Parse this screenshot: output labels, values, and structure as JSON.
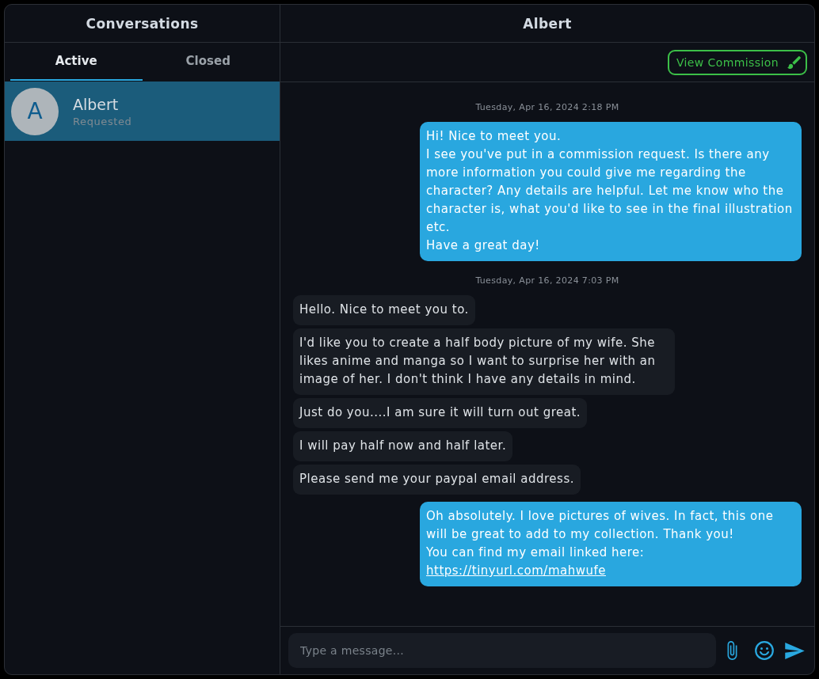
{
  "sidebar": {
    "title": "Conversations",
    "tabs": [
      {
        "label": "Active",
        "selected": true
      },
      {
        "label": "Closed",
        "selected": false
      }
    ],
    "conversations": [
      {
        "initial": "A",
        "name": "Albert",
        "status": "Requested",
        "selected": true
      }
    ]
  },
  "chat": {
    "title": "Albert",
    "action_button": "View Commission",
    "messages": [
      {
        "kind": "timestamp",
        "text": "Tuesday, Apr 16, 2024 2:18 PM"
      },
      {
        "kind": "sent",
        "text": "Hi! Nice to meet you.\nI see you've put in a commission request. Is there any more information you could give me regarding the character? Any details are helpful. Let me know who the character is, what you'd like to see in the final illustration etc.\nHave a great day!"
      },
      {
        "kind": "timestamp",
        "text": "Tuesday, Apr 16, 2024 7:03 PM"
      },
      {
        "kind": "received",
        "text": "Hello. Nice to meet you to."
      },
      {
        "kind": "received",
        "text": "I'd like you to create a half body picture of my wife. She likes anime and manga so I want to surprise her with an image of her. I don't think I have any details in mind."
      },
      {
        "kind": "received",
        "text": "Just do you....I am sure it will turn out great."
      },
      {
        "kind": "received",
        "text": "I will pay half now and half later."
      },
      {
        "kind": "received",
        "text": "Please send me your paypal email address."
      },
      {
        "kind": "sent",
        "text": "Oh absolutely. I love pictures of wives. In fact, this one will be great to add to my collection. Thank you!\nYou can find my email linked here:",
        "link": "https://tinyurl.com/mahwufe"
      }
    ],
    "composer": {
      "placeholder": "Type a message..."
    }
  }
}
